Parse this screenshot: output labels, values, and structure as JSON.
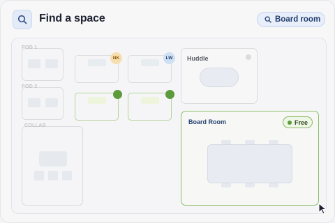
{
  "header": {
    "title": "Find a space",
    "search_icon": "search-icon",
    "selected_chip": "Board room"
  },
  "floor": {
    "zones": [
      {
        "label": "POD 1"
      },
      {
        "label": "POD 2"
      },
      {
        "label": "COLLAB"
      }
    ],
    "desks": [
      {
        "occupant": "NK",
        "status": "occupied"
      },
      {
        "occupant": "LW",
        "status": "occupied"
      },
      {
        "occupant": "",
        "status": "available"
      },
      {
        "occupant": "",
        "status": "available"
      }
    ],
    "rooms": [
      {
        "name": "Huddle",
        "status": "unavailable"
      },
      {
        "name": "Board Room",
        "status": "Free"
      }
    ]
  },
  "colors": {
    "accent": "#2f4f86",
    "available": "#5c9a3c",
    "nk_avatar": "#f6dfae",
    "lw_avatar": "#cfe0f5"
  }
}
